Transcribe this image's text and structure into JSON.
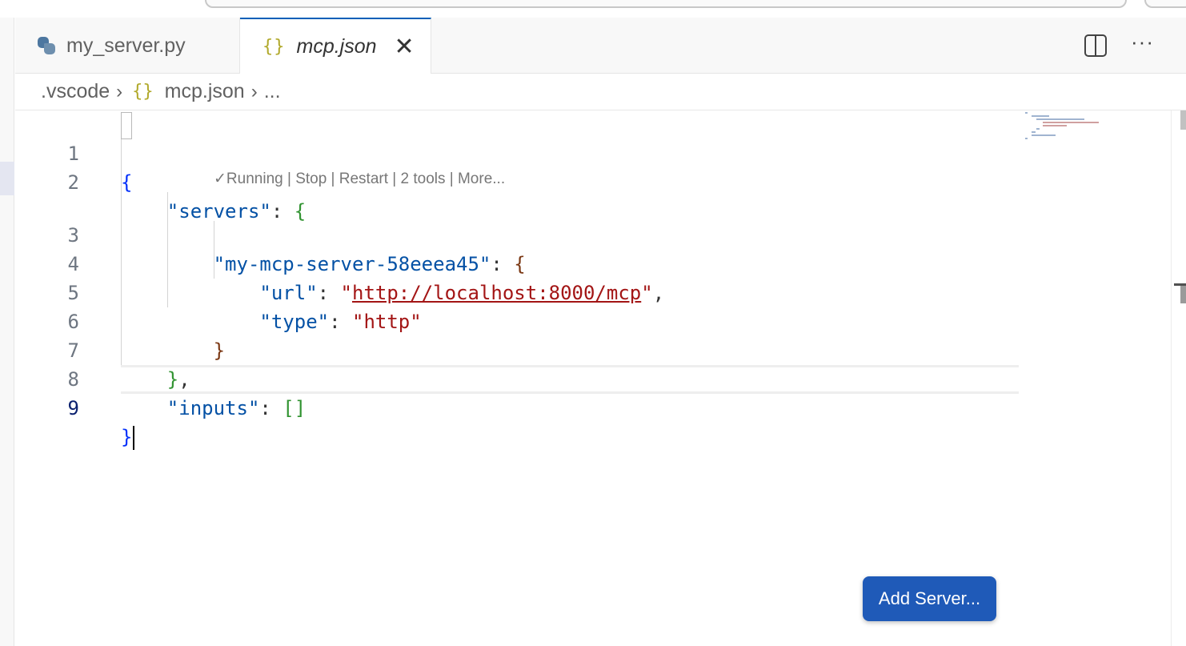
{
  "tabs": [
    {
      "label": "my_server.py",
      "icon": "python-icon",
      "active": false
    },
    {
      "label": "mcp.json",
      "icon": "json-braces-icon",
      "active": true
    }
  ],
  "tab_actions": {
    "split": "split-editor-icon",
    "more": "···"
  },
  "breadcrumb": {
    "folder": ".vscode",
    "file_icon": "{}",
    "file": "mcp.json",
    "more": "..."
  },
  "json_icon_glyph": "{}",
  "close_glyph": "✕",
  "codelens": "✓Running | Stop | Restart | 2 tools | More...",
  "lines": {
    "n1": "1",
    "n2": "2",
    "n3": "3",
    "n4": "4",
    "n5": "5",
    "n6": "6",
    "n7": "7",
    "n8": "8",
    "n9": "9"
  },
  "code": {
    "servers_key": "\"servers\"",
    "server_name_key": "\"my-mcp-server-58eeea45\"",
    "url_key": "\"url\"",
    "url_value": "http://localhost:8000/mcp",
    "type_key": "\"type\"",
    "type_value": "\"http\"",
    "inputs_key": "\"inputs\""
  },
  "add_server_button": "Add Server...",
  "colors": {
    "accent": "#1f5ab8",
    "tab_active_border": "#005fb8",
    "json_key": "#0451a5",
    "json_string": "#a31515"
  }
}
